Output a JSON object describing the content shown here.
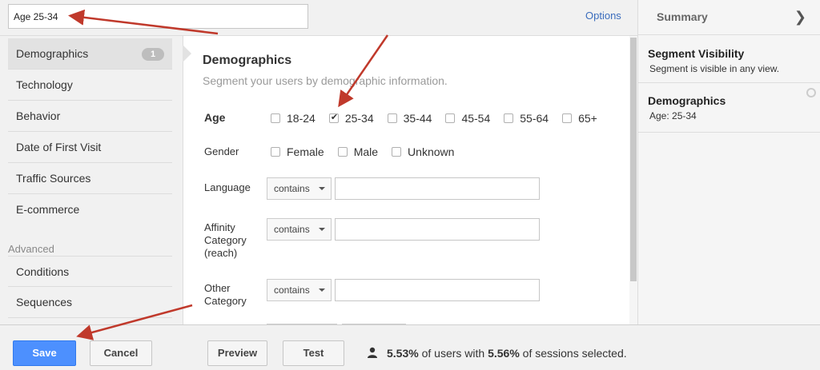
{
  "segment": {
    "name_value": "Age 25-34"
  },
  "options_label": "Options",
  "nav": {
    "items": [
      {
        "label": "Demographics",
        "badge": "1"
      },
      {
        "label": "Technology"
      },
      {
        "label": "Behavior"
      },
      {
        "label": "Date of First Visit"
      },
      {
        "label": "Traffic Sources"
      },
      {
        "label": "E-commerce"
      }
    ],
    "advanced_label": "Advanced",
    "advanced_items": [
      {
        "label": "Conditions"
      },
      {
        "label": "Sequences"
      }
    ]
  },
  "main": {
    "title": "Demographics",
    "subtitle": "Segment your users by demographic information.",
    "age": {
      "label": "Age",
      "options": [
        {
          "label": "18-24",
          "checked": false
        },
        {
          "label": "25-34",
          "checked": true
        },
        {
          "label": "35-44",
          "checked": false
        },
        {
          "label": "45-54",
          "checked": false
        },
        {
          "label": "55-64",
          "checked": false
        },
        {
          "label": "65+",
          "checked": false
        }
      ]
    },
    "gender": {
      "label": "Gender",
      "options": [
        {
          "label": "Female",
          "checked": false
        },
        {
          "label": "Male",
          "checked": false
        },
        {
          "label": "Unknown",
          "checked": false
        }
      ]
    },
    "language": {
      "label": "Language",
      "operator": "contains",
      "value": ""
    },
    "affinity": {
      "label_line1": "Affinity",
      "label_line2": "Category",
      "label_line3": "(reach)",
      "operator": "contains",
      "value": ""
    },
    "other": {
      "label_line1": "Other",
      "label_line2": "Category",
      "operator": "contains",
      "value": ""
    }
  },
  "summary": {
    "title": "Summary",
    "visibility_title": "Segment Visibility",
    "visibility_text": "Segment is visible in any view.",
    "demo_title": "Demographics",
    "demo_text": "Age: 25-34"
  },
  "footer": {
    "save": "Save",
    "cancel": "Cancel",
    "preview": "Preview",
    "test": "Test",
    "users_pct": "5.53%",
    "stats_mid": " of users with ",
    "sessions_pct": "5.56%",
    "stats_end": " of sessions selected."
  },
  "colors": {
    "primary_button": "#4d90fe",
    "link": "#3b6dbd",
    "annotation_arrow": "#c0392b"
  }
}
